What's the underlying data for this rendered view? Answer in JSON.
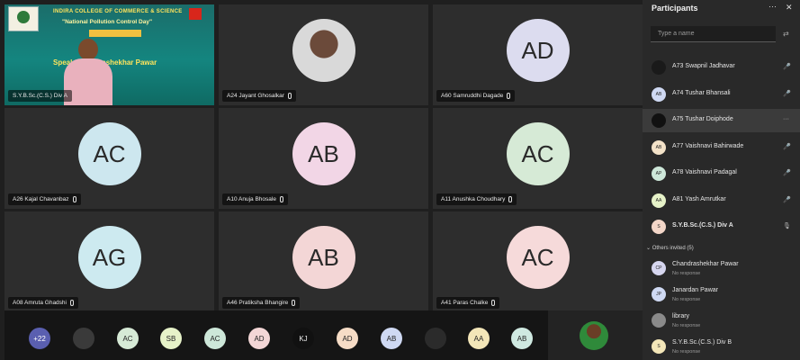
{
  "presentation": {
    "college_line": "INDIRA COLLEGE OF COMMERCE & SCIENCE",
    "event_line": "\"National Pollution Control Day\"",
    "speaker_line": "Speak___andrashekhar Pawar",
    "label": "S.Y.B.Sc.(C.S.) Div A"
  },
  "tiles": [
    {
      "name": "A24 Jayant Ghosalkar",
      "initials": "",
      "color": "#d0d0d0"
    },
    {
      "name": "A60 Samruddhi Dagade",
      "initials": "AD",
      "color": "#dcdcef"
    },
    {
      "name": "A26 Kajal Chavanbaz",
      "initials": "AC",
      "color": "#cde7ef"
    },
    {
      "name": "A10 Anuja Bhosale",
      "initials": "AB",
      "color": "#f2d6e6"
    },
    {
      "name": "A11 Anushka Choudhary",
      "initials": "AC",
      "color": "#d6ead6"
    },
    {
      "name": "A08 Amruta Ghadshi",
      "initials": "AG",
      "color": "#cdeaf0"
    },
    {
      "name": "A46 Pratiksha Bhangire",
      "initials": "AB",
      "color": "#f3d6d6"
    },
    {
      "name": "A41 Paras Chalke",
      "initials": "AC",
      "color": "#f6dada"
    }
  ],
  "bottom_avatars": [
    {
      "initials": "+22",
      "color": "#5a5fb0"
    },
    {
      "initials": "",
      "color": "#3a3a3a"
    },
    {
      "initials": "AC",
      "color": "#d6ead6"
    },
    {
      "initials": "SB",
      "color": "#e6f2c8"
    },
    {
      "initials": "AC",
      "color": "#cde7d9"
    },
    {
      "initials": "AD",
      "color": "#f3d6d6"
    },
    {
      "initials": "KJ",
      "color": "#111111"
    },
    {
      "initials": "AD",
      "color": "#f6dcc6"
    },
    {
      "initials": "AB",
      "color": "#cfd9f3"
    },
    {
      "initials": "",
      "color": "#2b2b2b"
    },
    {
      "initials": "AA",
      "color": "#f3e6b8"
    },
    {
      "initials": "AB",
      "color": "#cfe9e1"
    }
  ],
  "panel": {
    "title": "Participants",
    "more": "···",
    "close": "✕",
    "search_placeholder": "Type a name",
    "participants": [
      {
        "name": "A73 Swapnil Jadhavar",
        "initials": "",
        "color": "#1a1a1a",
        "muted": "🎤",
        "bold": false,
        "selected": false
      },
      {
        "name": "A74 Tushar Bhansali",
        "initials": "AB",
        "color": "#cfd9f3",
        "muted": "🎤",
        "bold": false,
        "selected": false
      },
      {
        "name": "A75 Tushar Doiphode",
        "initials": "",
        "color": "#111111",
        "muted": "···",
        "bold": false,
        "selected": true
      },
      {
        "name": "A77 Vaishnavi Bahirwade",
        "initials": "AB",
        "color": "#f3e2c8",
        "muted": "🎤",
        "bold": false,
        "selected": false
      },
      {
        "name": "A78 Vaishnavi Padagal",
        "initials": "AP",
        "color": "#cde7d9",
        "muted": "🎤",
        "bold": false,
        "selected": false
      },
      {
        "name": "A81 Yash Amrutkar",
        "initials": "AA",
        "color": "#e6f2c8",
        "muted": "🎤",
        "bold": false,
        "selected": false
      },
      {
        "name": "S.Y.B.Sc.(C.S.) Div A",
        "initials": "S",
        "color": "#f3d6c8",
        "muted": "🎙",
        "bold": true,
        "selected": false
      }
    ],
    "others_label": "Others invited (5)",
    "invited": [
      {
        "name": "Chandrashekhar Pawar",
        "sub": "No response",
        "initials": "CP",
        "color": "#d6d6ef"
      },
      {
        "name": "Janardan Pawar",
        "sub": "No response",
        "initials": "JP",
        "color": "#cfd9f3"
      },
      {
        "name": "library",
        "sub": "No response",
        "initials": "",
        "color": "#8a8a8a"
      },
      {
        "name": "S.Y.B.Sc.(C.S.) Div B",
        "sub": "No response",
        "initials": "S",
        "color": "#f3e6b8"
      }
    ]
  }
}
